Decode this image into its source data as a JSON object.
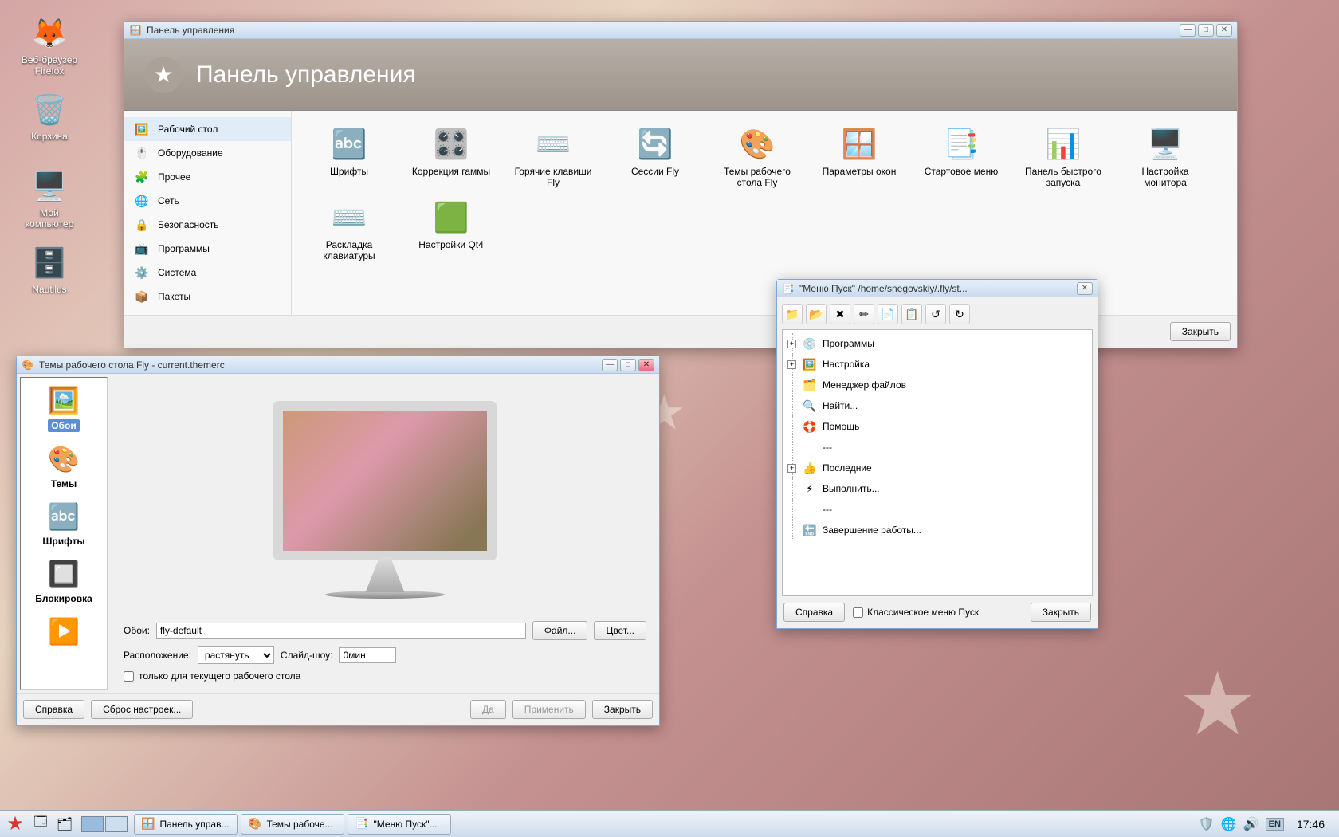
{
  "desktop_icons": [
    {
      "name": "firefox",
      "label": "Веб-браузер\nFirefox",
      "glyph": "🦊"
    },
    {
      "name": "trash",
      "label": "Корзина",
      "glyph": "🗑️"
    },
    {
      "name": "computer",
      "label": "Мой\nкомпьютер",
      "glyph": "🖥️"
    },
    {
      "name": "nautilus",
      "label": "Nautilus",
      "glyph": "🗄️"
    }
  ],
  "control_panel": {
    "window_title": "Панель управления",
    "header": "Панель управления",
    "sidebar": [
      {
        "label": "Рабочий стол",
        "glyph": "🖼️",
        "active": true
      },
      {
        "label": "Оборудование",
        "glyph": "🖱️"
      },
      {
        "label": "Прочее",
        "glyph": "🧩"
      },
      {
        "label": "Сеть",
        "glyph": "🌐"
      },
      {
        "label": "Безопасность",
        "glyph": "🔒"
      },
      {
        "label": "Программы",
        "glyph": "📺"
      },
      {
        "label": "Система",
        "glyph": "⚙️"
      },
      {
        "label": "Пакеты",
        "glyph": "📦"
      }
    ],
    "items": [
      {
        "label": "Шрифты",
        "glyph": "🔤"
      },
      {
        "label": "Коррекция гаммы",
        "glyph": "🎛️"
      },
      {
        "label": "Горячие клавиши Fly",
        "glyph": "⌨️"
      },
      {
        "label": "Сессии Fly",
        "glyph": "🔄"
      },
      {
        "label": "Темы рабочего стола Fly",
        "glyph": "🎨"
      },
      {
        "label": "Параметры окон",
        "glyph": "🪟"
      },
      {
        "label": "Стартовое меню",
        "glyph": "📑"
      },
      {
        "label": "Панель быстрого запуска",
        "glyph": "📊"
      },
      {
        "label": "Настройка монитора",
        "glyph": "🖥️"
      },
      {
        "label": "Раскладка клавиатуры",
        "glyph": "⌨️"
      },
      {
        "label": "Настройки Qt4",
        "glyph": "🟩"
      }
    ],
    "close": "Закрыть"
  },
  "themes": {
    "window_title": "Темы рабочего стола Fly - current.themerc",
    "side": [
      {
        "label": "Обои",
        "glyph": "🖼️",
        "sel": true
      },
      {
        "label": "Темы",
        "glyph": "🎨"
      },
      {
        "label": "Шрифты",
        "glyph": "🔤"
      },
      {
        "label": "Блокировка",
        "glyph": "🔲"
      },
      {
        "label": "",
        "glyph": "▶️"
      }
    ],
    "labels": {
      "wallpaper": "Обои:",
      "wallpaper_value": "fly-default",
      "file_btn": "Файл...",
      "color_btn": "Цвет...",
      "layout": "Расположение:",
      "layout_value": "растянуть",
      "slideshow": "Слайд-шоу:",
      "slideshow_value": "0мин.",
      "checkbox": "только для текущего рабочего стола",
      "help": "Справка",
      "reset": "Сброс настроек...",
      "yes": "Да",
      "apply": "Применить",
      "close": "Закрыть"
    }
  },
  "startmenu": {
    "window_title": "\"Меню Пуск\" /home/snegovskiy/.fly/st...",
    "tree": [
      {
        "label": "Программы",
        "glyph": "💿",
        "exp": "+"
      },
      {
        "label": "Настройка",
        "glyph": "🖼️",
        "exp": "+"
      },
      {
        "label": "Менеджер файлов",
        "glyph": "🗂️"
      },
      {
        "label": "Найти...",
        "glyph": "🔍"
      },
      {
        "label": "Помощь",
        "glyph": "🛟"
      },
      {
        "label": "---",
        "glyph": ""
      },
      {
        "label": "Последние",
        "glyph": "👍",
        "exp": "+"
      },
      {
        "label": "Выполнить...",
        "glyph": "⚡"
      },
      {
        "label": "---",
        "glyph": ""
      },
      {
        "label": "Завершение работы...",
        "glyph": "🔚"
      }
    ],
    "buttons": {
      "help": "Справка",
      "classic": "Классическое меню Пуск",
      "close": "Закрыть"
    }
  },
  "taskbar": {
    "tasks": [
      {
        "label": "Панель управ...",
        "glyph": "🪟"
      },
      {
        "label": "Темы рабоче...",
        "glyph": "🎨"
      },
      {
        "label": "\"Меню Пуск\"...",
        "glyph": "📑"
      }
    ],
    "lang": "EN",
    "clock": "17:46"
  }
}
